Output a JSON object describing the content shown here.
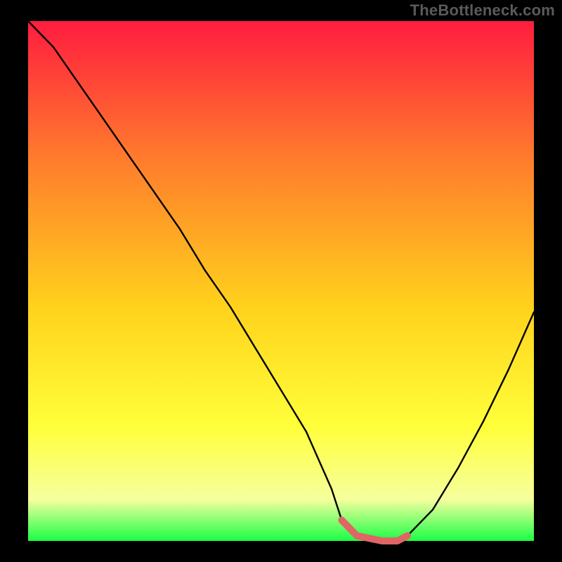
{
  "watermark": "TheBottleneck.com",
  "colors": {
    "background": "#000000",
    "gradient_top": "#ff1c3f",
    "gradient_mid1": "#ff7a2d",
    "gradient_mid2": "#ffd21c",
    "gradient_mid3": "#ffff3a",
    "gradient_mid4": "#f6ff9e",
    "gradient_bottom": "#1aff46",
    "curve": "#000000",
    "highlight": "#e06666",
    "watermark": "#5a5a5a"
  },
  "chart_data": {
    "type": "line",
    "title": "",
    "xlabel": "",
    "ylabel": "",
    "ylim": [
      0,
      100
    ],
    "xlim": [
      0,
      100
    ],
    "series": [
      {
        "name": "bottleneck-curve",
        "x": [
          0,
          5,
          10,
          15,
          20,
          25,
          30,
          35,
          40,
          45,
          50,
          55,
          60,
          62,
          65,
          70,
          73,
          75,
          80,
          85,
          90,
          95,
          100
        ],
        "values": [
          100,
          95,
          88,
          81,
          74,
          67,
          60,
          52,
          45,
          37,
          29,
          21,
          10,
          4,
          1,
          0,
          0,
          1,
          6,
          14,
          23,
          33,
          44
        ]
      }
    ],
    "highlight_segment": {
      "name": "flat-minimum-marker",
      "x": [
        62,
        65,
        70,
        73,
        75
      ],
      "values": [
        4,
        1,
        0,
        0,
        1
      ]
    },
    "annotations": []
  }
}
